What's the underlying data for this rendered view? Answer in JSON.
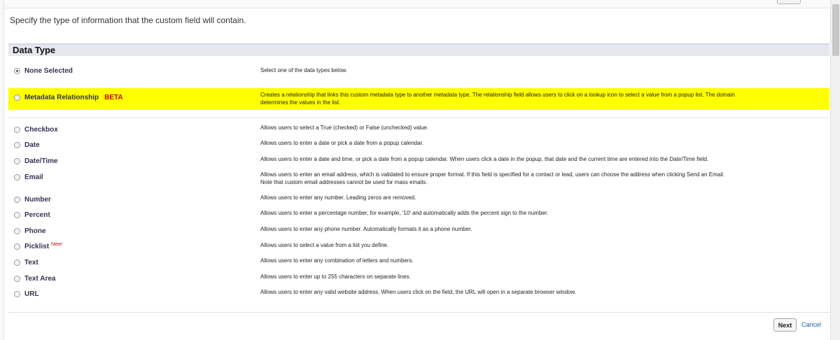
{
  "instruction": "Specify the type of information that the custom field will contain.",
  "section": {
    "title": "Data Type"
  },
  "options": [
    {
      "label": "None Selected",
      "desc_lines": [
        "Select one of the data types below."
      ],
      "checked": true
    },
    {
      "label": "Metadata Relationship",
      "tag": "BETA",
      "highlight": true,
      "desc_lines": [
        "Creates a relationship that links this custom metadata type to another metadata type. The relationship field allows users to click on a lookup icon to select a value from a popup list. The domain",
        "determines the values in the list."
      ]
    },
    {
      "label": "Checkbox",
      "desc_lines": [
        "Allows users to select a True (checked) or False (unchecked) value."
      ]
    },
    {
      "label": "Date",
      "desc_lines": [
        "Allows users to enter a date or pick a date from a popup calendar."
      ]
    },
    {
      "label": "Date/Time",
      "desc_lines": [
        "Allows users to enter a date and time, or pick a date from a popup calendar. When users click a date in the popup, that date and the current time are entered into the Date/Time field."
      ]
    },
    {
      "label": "Email",
      "desc_lines": [
        "Allows users to enter an email address, which is validated to ensure proper format. If this field is specified for a contact or lead, users can choose the address when clicking Send an Email.",
        "Note that custom email addresses cannot be used for mass emails."
      ]
    },
    {
      "label": "Number",
      "desc_lines": [
        "Allows users to enter any number. Leading zeros are removed."
      ]
    },
    {
      "label": "Percent",
      "desc_lines": [
        "Allows users to enter a percentage number, for example, '10' and automatically adds the percent sign to the number."
      ]
    },
    {
      "label": "Phone",
      "desc_lines": [
        "Allows users to enter any phone number. Automatically formats it as a phone number."
      ]
    },
    {
      "label": "Picklist",
      "newtag": "New!",
      "desc_lines": [
        "Allows users to select a value from a list you define."
      ]
    },
    {
      "label": "Text",
      "desc_lines": [
        "Allows users to enter any combination of letters and numbers."
      ]
    },
    {
      "label": "Text Area",
      "desc_lines": [
        "Allows users to enter up to 255 characters on separate lines."
      ]
    },
    {
      "label": "URL",
      "desc_lines": [
        "Allows users to enter any valid website address. When users click on the field, the URL will open in a separate browser window."
      ]
    }
  ],
  "buttons": {
    "next": "Next",
    "cancel": "Cancel"
  },
  "colors": {
    "highlight": "#ffff00",
    "beta": "#d00000",
    "link": "#1f5ea8",
    "header_bg": "#e5e7ef"
  }
}
